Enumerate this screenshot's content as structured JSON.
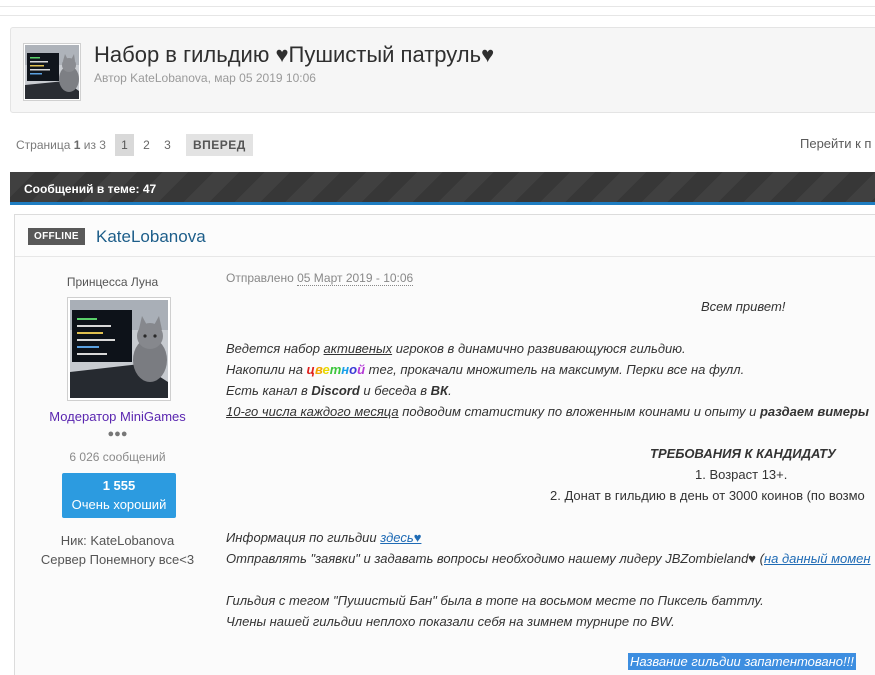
{
  "topic": {
    "title": "Набор в гильдию ♥Пушистый патруль♥",
    "meta_prefix": "Автор",
    "meta_author": "KateLobanova",
    "meta_date": ", мар 05 2019 10:06"
  },
  "pager": {
    "label_prefix": "Страница",
    "label_current": "1",
    "label_suffix": "из 3",
    "pages": [
      "1",
      "2",
      "3"
    ],
    "next_label": "ВПЕРЕД",
    "jump_label": "Перейти к п"
  },
  "post_bar": {
    "text": "Сообщений в теме: 47"
  },
  "post": {
    "status_badge": "OFFLINE",
    "author": "KateLobanova",
    "rank_title": "Принцесса Луна",
    "group": "Модератор MiniGames",
    "pips": "●●●",
    "post_count": "6 026 сообщений",
    "reputation_value": "1 555",
    "reputation_label": "Очень хороший",
    "nick_label": "Ник:",
    "nick_value": "KateLobanova",
    "server_label": "Сервер",
    "server_value": "Понемногу все<3",
    "sent_prefix": "Отправлено",
    "sent_date": "05 Март 2019 - 10:06",
    "body": {
      "greeting": "Всем привет!",
      "l1_a": "Ведется набор ",
      "l1_b": "активеных",
      "l1_c": " игроков в динамично развивающуюся гильдию.",
      "l2_a": "Накопили на ",
      "l2_rainbow": [
        "ц",
        "в",
        "е",
        "т",
        "н",
        "о",
        "й"
      ],
      "l2_c": " тег, прокачали множитель на максимум. Перки все на фулл.",
      "l3_a": "Есть канал в ",
      "l3_b": "Discord",
      "l3_c": " и беседа в ",
      "l3_d": "ВК",
      "l3_e": ".",
      "l4_a": "10-го числа каждого месяца",
      "l4_b": " подводим статистику по вложенным коинами и опыту и ",
      "l4_c": "раздаем вимеры",
      "req_title": "ТРЕБОВАНИЯ К КАНДИДАТУ",
      "req_1": "1. Возраст 13+.",
      "req_2": "2. Донат в гильдию в день от 3000 коинов (по возмо",
      "info_a": "Информация по гильдии  ",
      "info_link": "здесь♥",
      "send_a": "Отправлять \"заявки\" и задавать вопросы необходимо нашему лидеру JBZombieland♥ (",
      "send_link": "на данный момен",
      "tag_line": "Гильдия с тегом \"Пушистый Бан\" была в топе на восьмом месте по Пиксель баттлу.",
      "bw_line": "Члены нашей гильдии неплохо показали себя на зимнем турнире по BW.",
      "patent": "Название гильдии запатентовано!!!"
    }
  },
  "colors": {
    "rainbow": [
      "#e0211d",
      "#f2a500",
      "#e8d800",
      "#3cc63c",
      "#1aa0e8",
      "#3a3ad6",
      "#b43ad6"
    ],
    "accent": "#1f7dc1",
    "reputation_bg": "#2c9be0",
    "group_color": "#5a26b0"
  },
  "icons": {
    "topic_avatar": "cat-at-laptop-avatar",
    "author_avatar": "cat-at-laptop-avatar"
  }
}
